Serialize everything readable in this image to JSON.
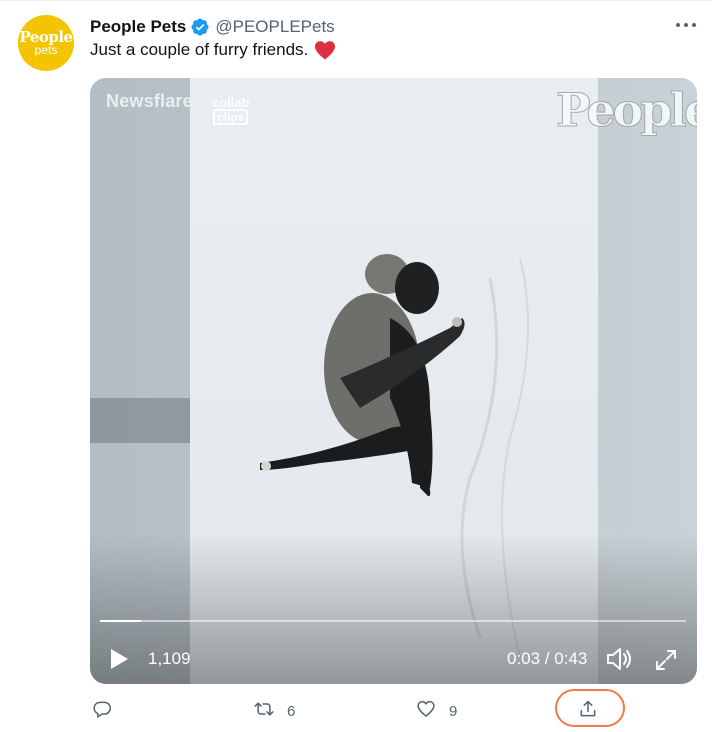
{
  "account": {
    "display_name": "People Pets",
    "handle": "@PEOPLEPets",
    "avatar_text": "People",
    "avatar_subtext": "pets",
    "avatar_color": "#f5c400",
    "verified": true
  },
  "tweet": {
    "text": "Just a couple of furry friends.",
    "emoji": "red-heart"
  },
  "video": {
    "watermarks": {
      "newsflare": "Newsflare",
      "collab_top": "collab",
      "collab_bottom": "clips",
      "people": "People"
    },
    "views": "1,109",
    "time": "0:03 / 0:43",
    "progress": 0.07
  },
  "actions": {
    "reply_count": "",
    "retweet_count": "6",
    "like_count": "9",
    "share_highlight_color": "#f07a4a"
  },
  "icons": [
    "verified-badge-icon",
    "more-icon",
    "heart-emoji-icon",
    "play-icon",
    "volume-icon",
    "fullscreen-icon",
    "reply-icon",
    "retweet-icon",
    "like-icon",
    "share-icon"
  ]
}
